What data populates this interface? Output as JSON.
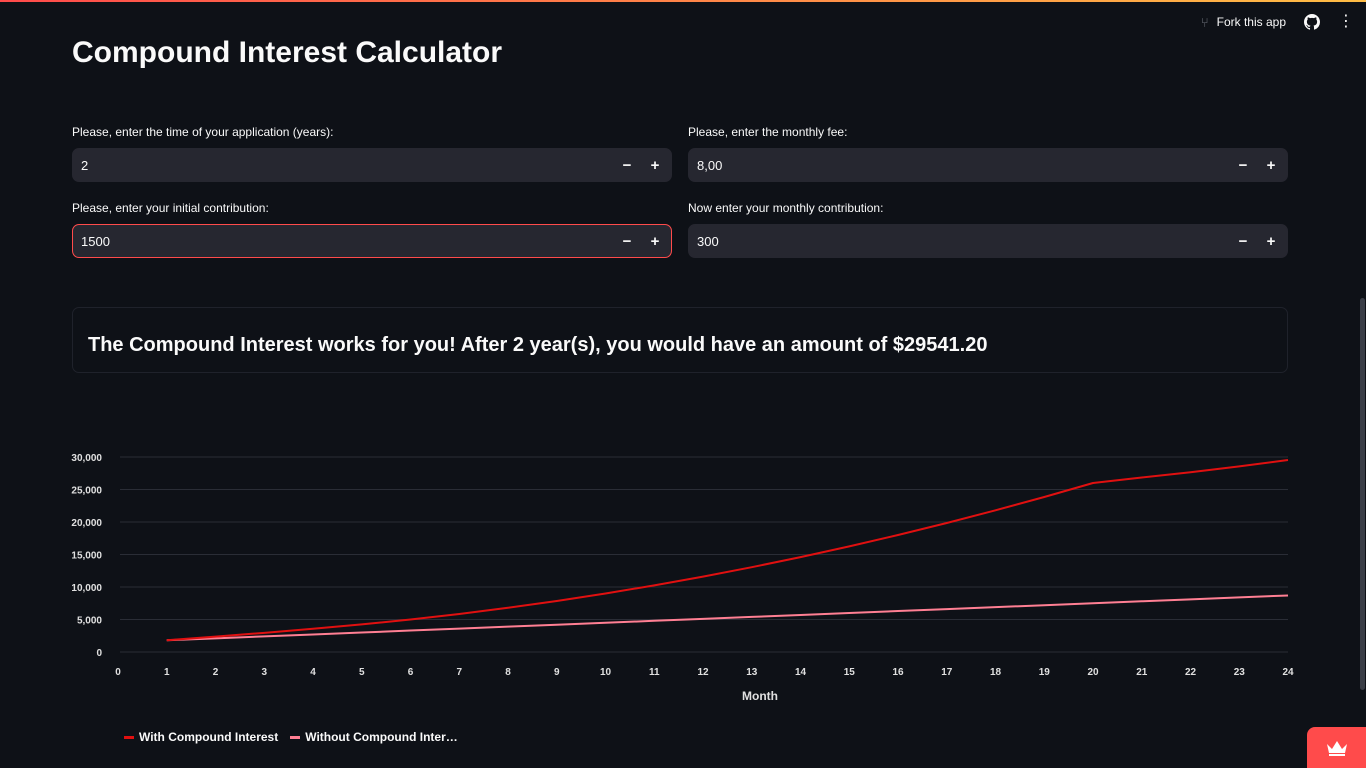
{
  "header": {
    "fork_label": "Fork this app",
    "fork_icon": "fork-icon",
    "github_icon": "github-icon",
    "menu_icon": "kebab-menu-icon"
  },
  "title": "Compound Interest Calculator",
  "inputs": {
    "years": {
      "label": "Please, enter the time of your application (years):",
      "value": "2"
    },
    "fee": {
      "label": "Please, enter the monthly fee:",
      "value": "8,00"
    },
    "initial": {
      "label": "Please, enter your initial contribution:",
      "value": "1500"
    },
    "monthly": {
      "label": "Now enter your monthly contribution:",
      "value": "300"
    },
    "minus": "−",
    "plus": "+"
  },
  "result": "The Compound Interest works for you! After 2 year(s), you would have an amount of $29541.20",
  "colors": {
    "accent": "#ff4b4b",
    "series_with": "#e01010",
    "series_without": "#ff7f93",
    "background": "#0e1117"
  },
  "chart_data": {
    "type": "line",
    "xlabel": "Month",
    "ylabel": "",
    "xlim": [
      0,
      24
    ],
    "ylim": [
      0,
      30000
    ],
    "x_ticks": [
      0,
      1,
      2,
      3,
      4,
      5,
      6,
      7,
      8,
      9,
      10,
      11,
      12,
      13,
      14,
      15,
      16,
      17,
      18,
      19,
      20,
      21,
      22,
      23,
      24
    ],
    "y_ticks": [
      0,
      5000,
      10000,
      15000,
      20000,
      25000,
      30000
    ],
    "y_tick_labels": [
      "0",
      "5,000",
      "10,000",
      "15,000",
      "20,000",
      "25,000",
      "30,000"
    ],
    "grid": true,
    "legend_position": "bottom-left",
    "x": [
      1,
      2,
      3,
      4,
      5,
      6,
      7,
      8,
      9,
      10,
      11,
      12,
      13,
      14,
      15,
      16,
      17,
      18,
      19,
      20,
      21,
      22,
      23,
      24
    ],
    "series": [
      {
        "name": "With Compound Interest",
        "color": "#e01010",
        "values": [
          1800,
          2360,
          2950,
          3570,
          4250,
          5000,
          5850,
          6800,
          7850,
          9000,
          10250,
          11600,
          13050,
          14600,
          16250,
          18000,
          19850,
          21800,
          23850,
          26000,
          26850,
          27650,
          28550,
          29541
        ]
      },
      {
        "name": "Without Compound Inter…",
        "color": "#ff7f93",
        "values": [
          1800,
          2100,
          2400,
          2700,
          3000,
          3300,
          3600,
          3900,
          4200,
          4500,
          4800,
          5100,
          5400,
          5700,
          6000,
          6300,
          6600,
          6900,
          7200,
          7500,
          7800,
          8100,
          8400,
          8700
        ]
      }
    ]
  }
}
